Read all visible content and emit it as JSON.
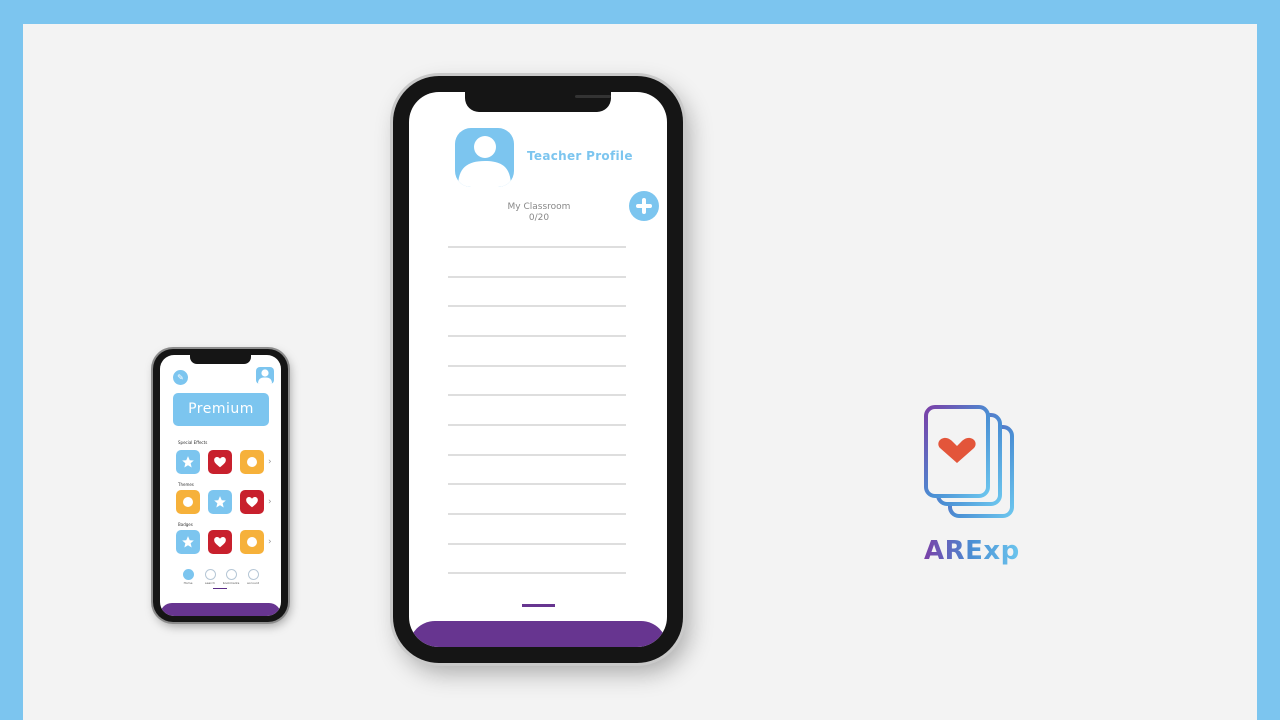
{
  "colors": {
    "frame": "#7cc5ef",
    "canvas": "#f3f3f3",
    "accent_blue": "#7cc5ef",
    "accent_purple": "#673590",
    "tile_red": "#c8202d",
    "tile_orange": "#f6b13a"
  },
  "small_phone": {
    "premium_label": "Premium",
    "sections": [
      {
        "label": "Special Effects",
        "tiles": [
          "star",
          "heart",
          "circle"
        ]
      },
      {
        "label": "Themes",
        "tiles": [
          "circle",
          "star",
          "heart"
        ]
      },
      {
        "label": "Badges",
        "tiles": [
          "star",
          "heart",
          "circle"
        ]
      }
    ],
    "nav": [
      {
        "label": "Home",
        "icon": "home-icon",
        "active": true
      },
      {
        "label": "search",
        "icon": "search-icon",
        "active": false
      },
      {
        "label": "bookmarks",
        "icon": "bookmark-icon",
        "active": false
      },
      {
        "label": "account",
        "icon": "account-icon",
        "active": false
      }
    ]
  },
  "large_phone": {
    "profile_title": "Teacher Profile",
    "classroom_label": "My Classroom",
    "classroom_count": "0/20",
    "add_icon": "plus-icon",
    "student_rows": 12
  },
  "brand": {
    "name": "ARExp",
    "icon": "stacked-cards-heart-icon"
  }
}
